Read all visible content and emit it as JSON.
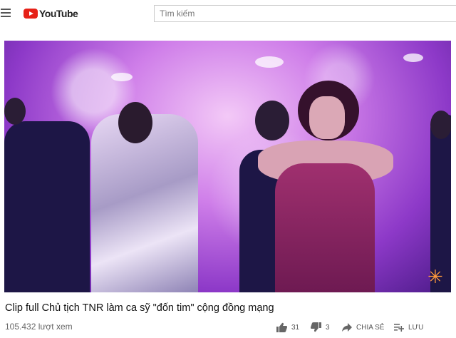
{
  "header": {
    "logo_text": "YouTube",
    "search_placeholder": "Tìm kiếm"
  },
  "video": {
    "title": "Clip full Chủ tịch TNR làm ca sỹ \"đốn tim\" cộng đồng mạng",
    "views": "105.432 lượt xem",
    "likes": "31",
    "dislikes": "3",
    "share_label": "CHIA SẺ",
    "save_label": "LƯU"
  },
  "icons": {
    "menu": "menu-icon",
    "logo": "youtube-logo-icon",
    "like": "thumbs-up-icon",
    "dislike": "thumbs-down-icon",
    "share": "share-arrow-icon",
    "save": "playlist-add-icon",
    "channel_watermark": "sparkle-icon"
  },
  "colors": {
    "brand_red": "#e62117",
    "stage_purple": "#9b4fd6"
  }
}
